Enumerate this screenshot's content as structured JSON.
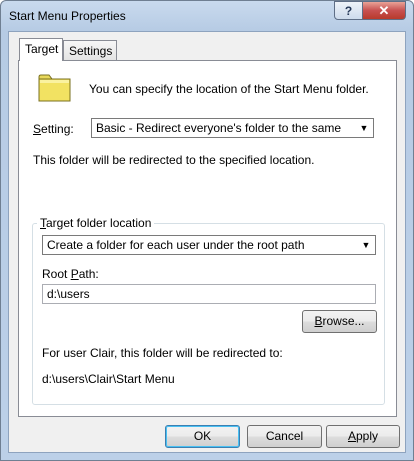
{
  "window": {
    "title": "Start Menu Properties"
  },
  "titlebar": {
    "help_label": "?",
    "close_label": "✕"
  },
  "tabs": [
    {
      "label": "Target",
      "active": true
    },
    {
      "label": "Settings",
      "active": false
    }
  ],
  "target": {
    "icon": "folder-icon",
    "description": "You can specify the location of the Start Menu folder.",
    "setting_label_rest": "etting:",
    "setting_label_u": "S",
    "setting_value": "Basic - Redirect everyone's folder to the same location",
    "redirect_text": "This folder will be redirected to the specified location.",
    "group": {
      "title_u": "T",
      "title_rest": "arget folder location",
      "location_value": "Create a folder for each user under the root path",
      "root_path_label_pre": "Root ",
      "root_path_label_u": "P",
      "root_path_label_post": "ath:",
      "root_path_value": "d:\\users",
      "browse_u": "B",
      "browse_rest": "rowse...",
      "user_text": "For user Clair, this folder will be redirected to:",
      "user_path": "d:\\users\\Clair\\Start Menu"
    }
  },
  "footer": {
    "ok_label": "OK",
    "cancel_label": "Cancel",
    "apply_u": "A",
    "apply_rest": "pply"
  },
  "colors": {
    "folder": "#f2e262",
    "close": "#c75050"
  }
}
